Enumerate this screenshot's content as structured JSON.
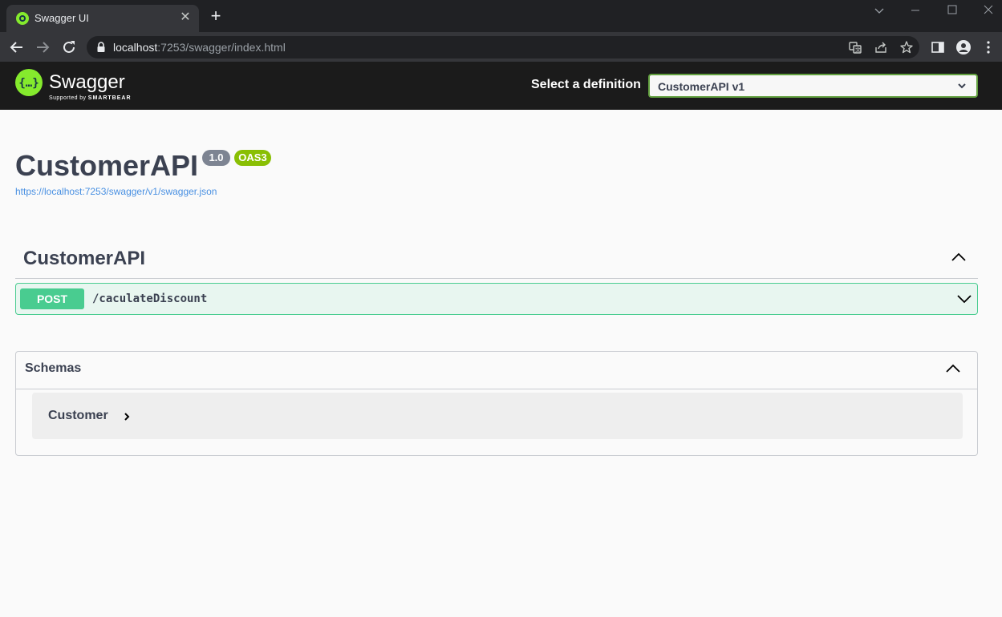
{
  "browser": {
    "tab_title": "Swagger UI",
    "tab_close": "✕",
    "new_tab": "+",
    "url_host": "localhost",
    "url_rest": ":7253/swagger/index.html"
  },
  "topbar": {
    "logo_text": "Swagger",
    "logo_sub_prefix": "Supported by ",
    "logo_sub_brand": "SMARTBEAR",
    "definition_label": "Select a definition",
    "definition_selected": "CustomerAPI v1"
  },
  "info": {
    "title": "CustomerAPI",
    "version": "1.0",
    "oas_badge": "OAS3",
    "spec_url": "https://localhost:7253/swagger/v1/swagger.json"
  },
  "operations": {
    "tag": "CustomerAPI",
    "items": [
      {
        "method": "POST",
        "path": "/caculateDiscount"
      }
    ]
  },
  "schemas": {
    "title": "Schemas",
    "models": [
      {
        "name": "Customer"
      }
    ]
  },
  "colors": {
    "post": "#49cc90",
    "post_bg": "#e8f6f0",
    "swagger_green": "#85ea2d",
    "topbar_bg": "#1b1b1b",
    "text": "#3b4151",
    "link": "#4990e2"
  }
}
